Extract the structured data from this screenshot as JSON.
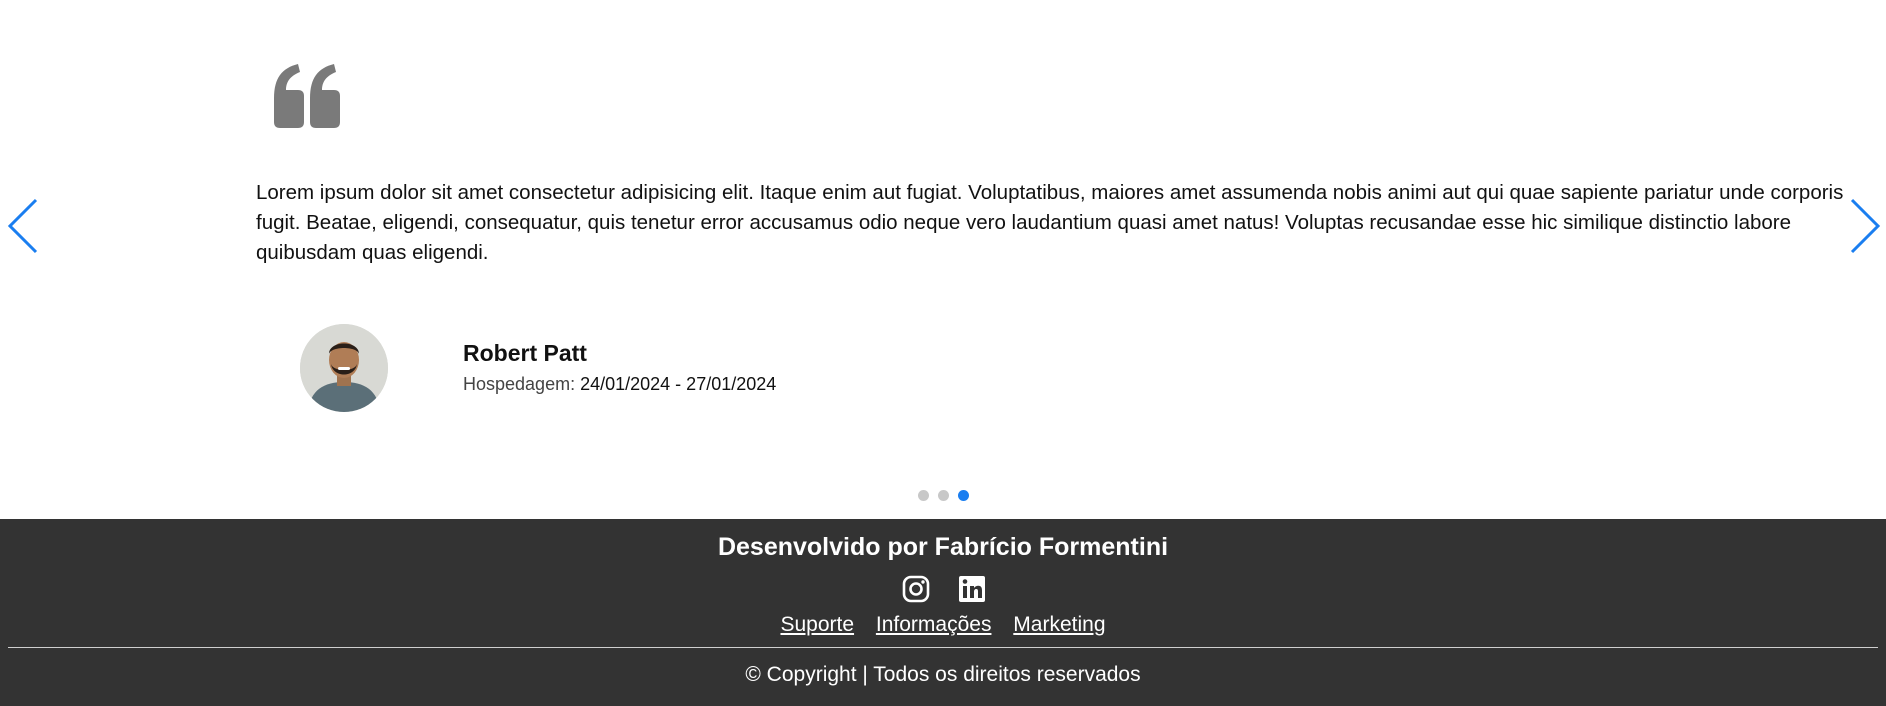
{
  "testimonial": {
    "quote_icon": "quote-icon",
    "text": "Lorem ipsum dolor sit amet consectetur adipisicing elit. Itaque enim aut fugiat. Voluptatibus, maiores amet assumenda nobis animi aut qui quae sapiente pariatur unde corporis fugit. Beatae, eligendi, consequatur, quis tenetur error accusamus odio neque vero laudantium quasi amet natus! Voluptas recusandae esse hic similique distinctio labore quibusdam quas eligendi.",
    "author": {
      "name": "Robert Patt",
      "stay_label": "Hospedagem:",
      "stay_dates": "24/01/2024 - 27/01/2024"
    }
  },
  "carousel": {
    "prev_icon": "chevron-left-icon",
    "next_icon": "chevron-right-icon",
    "slides": 3,
    "active_index": 2,
    "accent_color": "#1a7ef0"
  },
  "footer": {
    "title": "Desenvolvido por Fabrício Formentini",
    "social": [
      "instagram-icon",
      "linkedin-icon"
    ],
    "links": [
      "Suporte",
      "Informações",
      "Marketing"
    ],
    "copyright": "© Copyright | Todos os direitos reservados",
    "background": "#333333"
  }
}
